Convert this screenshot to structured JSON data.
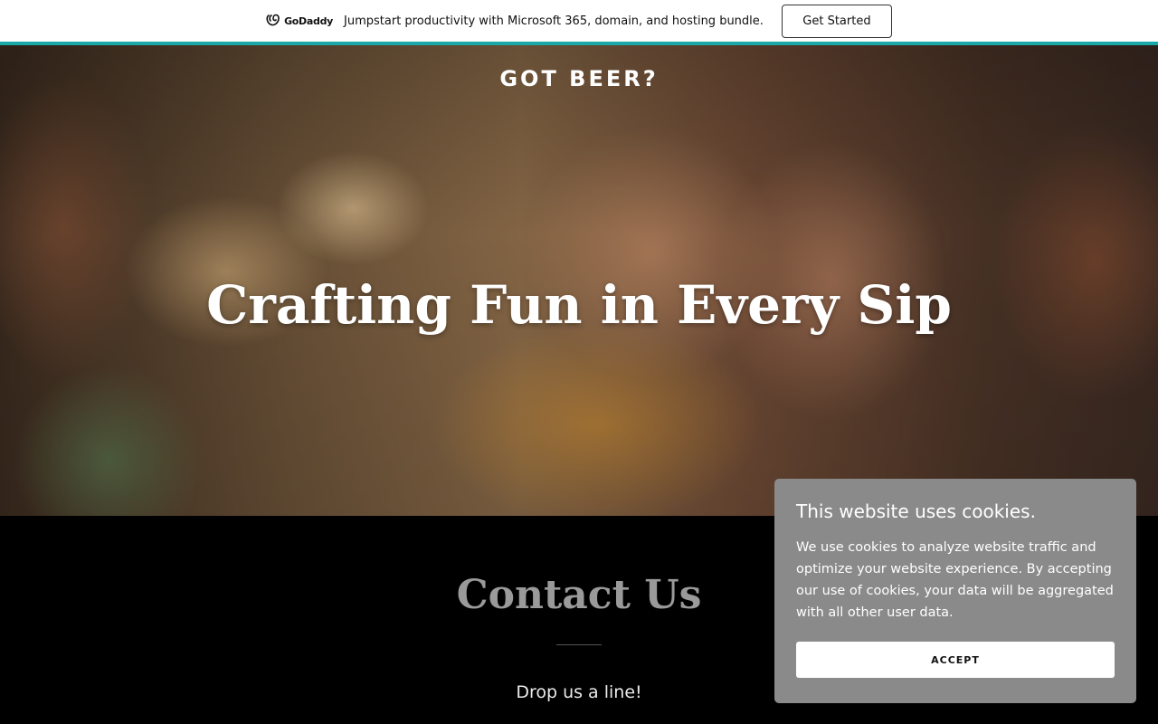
{
  "promo": {
    "logo_text": "GoDaddy",
    "logo_icon": "godaddy-logo-icon",
    "message": "Jumpstart productivity with Microsoft 365, domain, and hosting bundle.",
    "button_label": "Get Started",
    "accent_color": "#1aa8a8"
  },
  "hero": {
    "kicker": "GOT BEER?",
    "title": "Crafting Fun in Every Sip",
    "image_desc": "friends-toasting-beer-photo"
  },
  "contact": {
    "title": "Contact Us",
    "subtitle": "Drop us a line!"
  },
  "cookie_banner": {
    "title": "This website uses cookies.",
    "body": "We use cookies to analyze website traffic and optimize your website experience. By accepting our use of cookies, your data will be aggregated with all other user data.",
    "accept_label": "ACCEPT"
  }
}
